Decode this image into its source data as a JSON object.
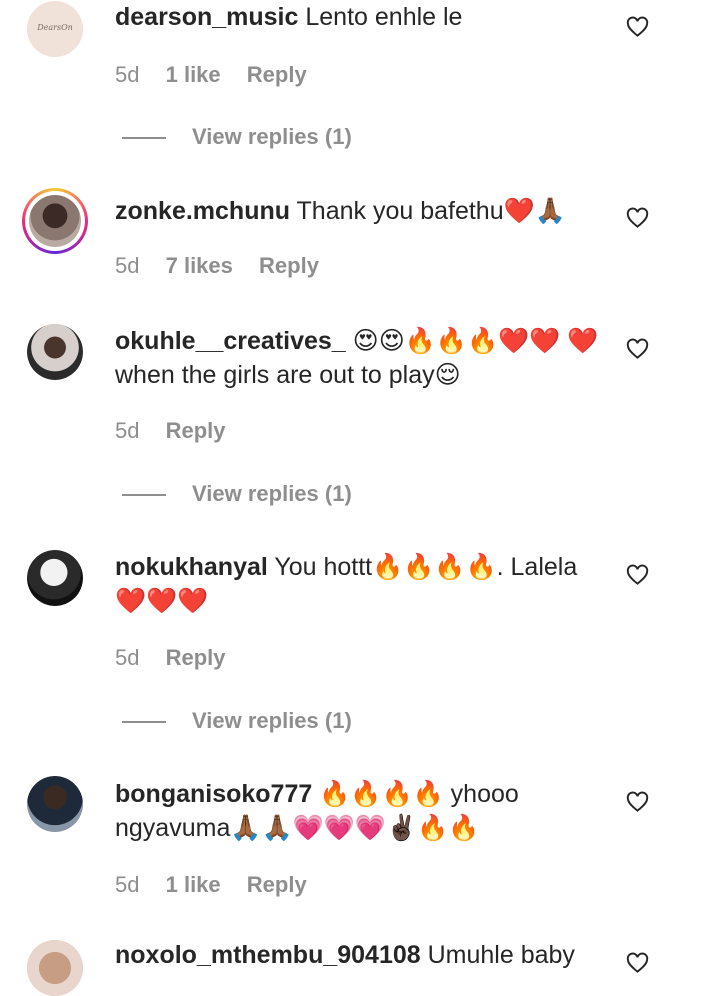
{
  "comments": [
    {
      "username": "dearson_music",
      "text": "Lento enhle le",
      "time": "5d",
      "likes": "1 like",
      "reply": "Reply",
      "view_replies": "View replies (1)",
      "avatar_text": "DearsOn"
    },
    {
      "username": "zonke.mchunu",
      "text": "Thank you bafethu❤️🙏🏾",
      "time": "5d",
      "likes": "7 likes",
      "reply": "Reply"
    },
    {
      "username": "okuhle__creatives_",
      "text": "😍😍🔥🔥🔥❤️❤️ ❤️when the girls are out to play😌",
      "time": "5d",
      "reply": "Reply",
      "view_replies": "View replies (1)"
    },
    {
      "username": "nokukhanyal",
      "text": "You hottt🔥🔥🔥🔥. Lalela ❤️❤️❤️",
      "time": "5d",
      "reply": "Reply",
      "view_replies": "View replies (1)"
    },
    {
      "username": "bonganisoko777",
      "text": "🔥🔥🔥🔥 yhooo ngyavuma🙏🏾🙏🏾💗💗💗✌🏿🔥🔥",
      "time": "5d",
      "likes": "1 like",
      "reply": "Reply"
    },
    {
      "username": "noxolo_mthembu_904108",
      "text": "Umuhle baby"
    }
  ],
  "colors": {
    "text": "#262626",
    "muted": "#8e8e8e"
  },
  "icons": {
    "like": "heart-outline-icon"
  }
}
